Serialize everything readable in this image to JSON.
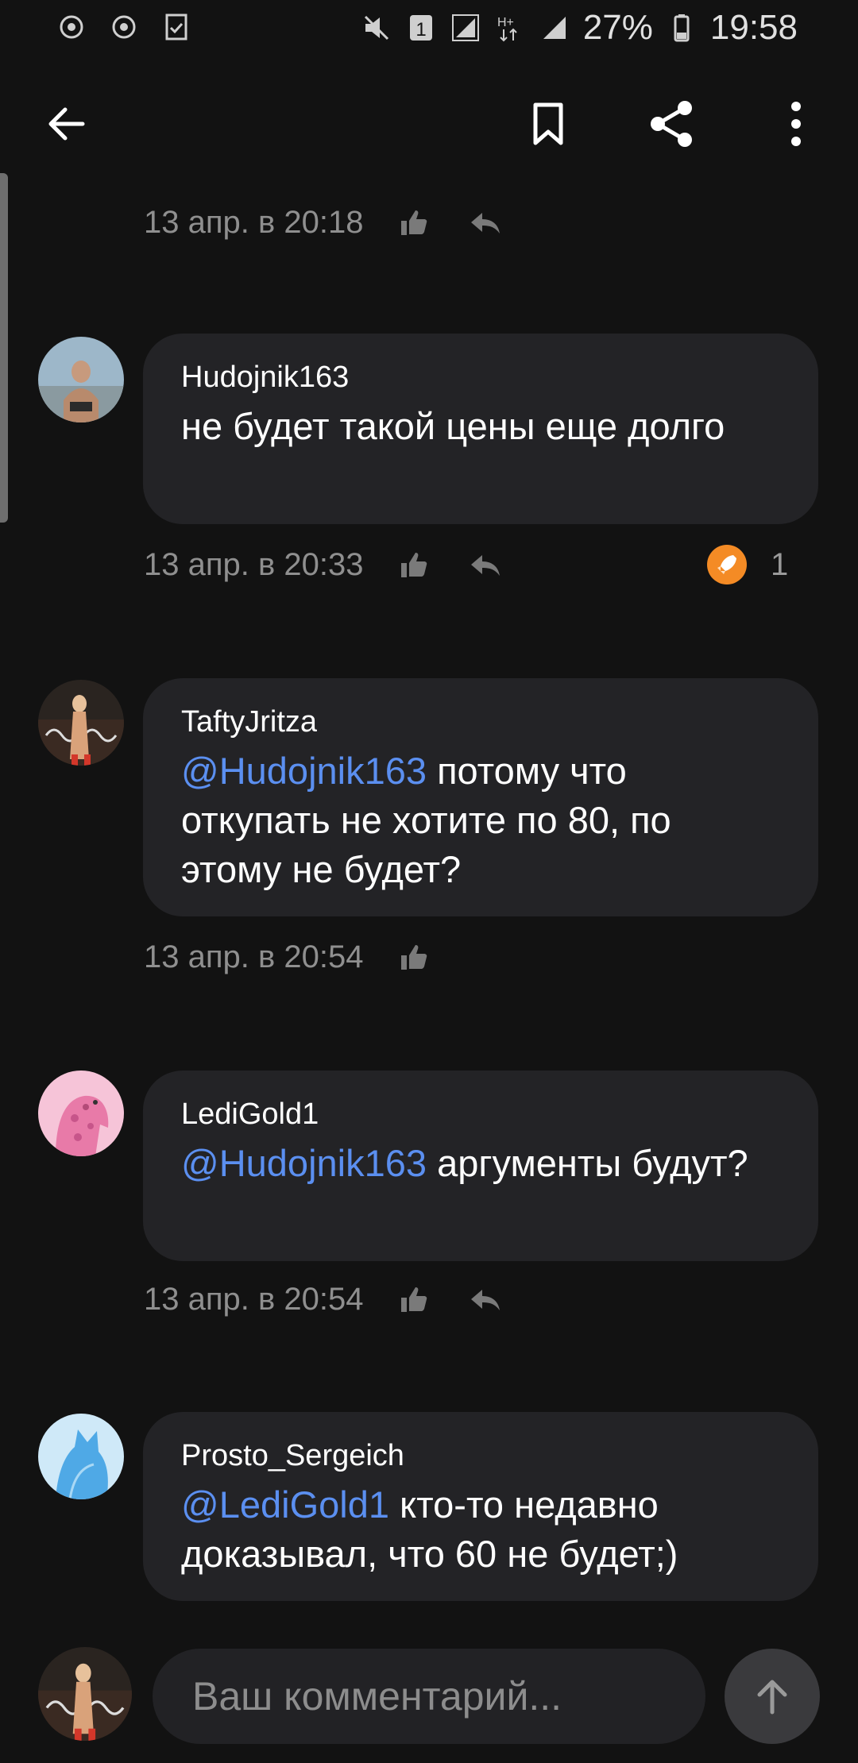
{
  "statusbar": {
    "battery": "27%",
    "time": "19:58",
    "icons": [
      "notification-icon",
      "notification-icon",
      "checklist-icon",
      "mute-icon",
      "sim1-icon",
      "signal-icon",
      "hplus-icon",
      "signal-icon",
      "battery-icon"
    ]
  },
  "appbar": {
    "icons": [
      "back-arrow-icon",
      "bookmark-icon",
      "share-icon",
      "more-vert-icon"
    ]
  },
  "comments": [
    {
      "time": "13 апр. в 20:18"
    },
    {
      "author": "Hudojnik163",
      "text": "не будет такой цены еще долго",
      "time": "13 апр. в 20:33",
      "reaction_count": "1"
    },
    {
      "author": "TaftyJritza",
      "mention": "@Hudojnik163",
      "text": " потому что откупать не хотите по 80, по этому не будет?",
      "time": "13 апр. в 20:54"
    },
    {
      "author": "LediGold1",
      "mention": "@Hudojnik163",
      "text": " аргументы будут?",
      "time": "13 апр. в 20:54"
    },
    {
      "author": "Prosto_Sergeich",
      "mention": "@LediGold1",
      "text": " кто-то недавно доказывал, что 60 не будет;)"
    }
  ],
  "composer": {
    "placeholder": "Ваш комментарий..."
  },
  "colors": {
    "background": "#121212",
    "bubble": "#232326",
    "mention": "#5b8ff0",
    "meta": "#8f8f8f",
    "rocket": "#f48b25"
  }
}
